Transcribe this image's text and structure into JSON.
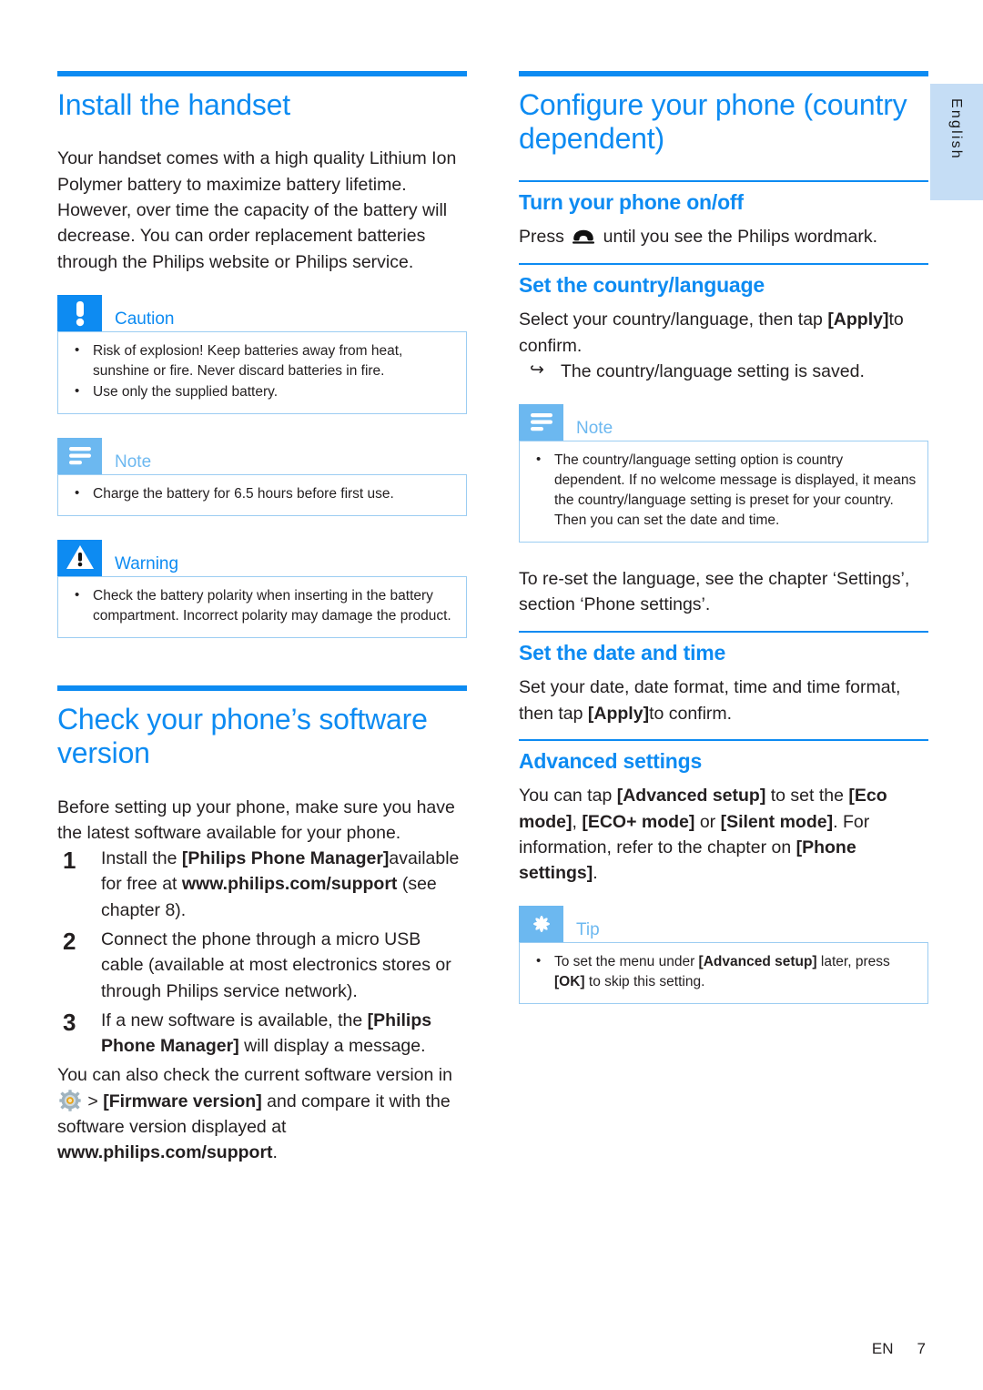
{
  "page": {
    "language_tab": "English",
    "footer_locale": "EN",
    "footer_page_number": "7",
    "accent_color": "#0d8bf2",
    "accent_light_color": "#6cb8f0",
    "tab_bg_color": "#c5ddf5"
  },
  "left_column": {
    "chapter_title": "Install the handset",
    "intro_paragraph": "Your handset comes with a high quality Lithium Ion Polymer battery to maximize battery lifetime. However, over time the capacity of the battery will decrease. You can order replacement batteries through the Philips website or Philips service.",
    "caution_box": {
      "icon": "exclamation-mark-icon",
      "title": "Caution",
      "items": [
        "Risk of explosion! Keep batteries away from heat, sunshine or fire. Never discard batteries in fire.",
        "Use only the supplied battery."
      ]
    },
    "note_box": {
      "icon": "note-lines-icon",
      "title": "Note",
      "items": [
        "Charge the battery for 6.5 hours before first use."
      ]
    },
    "warning_box": {
      "icon": "warning-triangle-icon",
      "title": "Warning",
      "items": [
        "Check the battery polarity when inserting in the battery compartment. Incorrect polarity may damage the product."
      ]
    },
    "chapter_title_2": "Check your phone’s software version",
    "intro_paragraph_2": "Before setting up your phone, make sure you have the latest software available for your phone.",
    "steps": [
      {
        "number": "1",
        "parts": [
          {
            "text": "Install the ",
            "bold": false
          },
          {
            "text": "[Philips Phone Manager]",
            "bold": true
          },
          {
            "text": "available for free at ",
            "bold": false
          },
          {
            "text": "www.philips.com/support",
            "bold": true
          },
          {
            "text": " (see chapter 8).",
            "bold": false
          }
        ]
      },
      {
        "number": "2",
        "parts": [
          {
            "text": "Connect the phone through a micro USB cable (available at most electronics stores or through Philips service network).",
            "bold": false
          }
        ]
      },
      {
        "number": "3",
        "parts": [
          {
            "text": "If a new software is available, the ",
            "bold": false
          },
          {
            "text": "[Philips Phone Manager]",
            "bold": true
          },
          {
            "text": " will display a message.",
            "bold": false
          }
        ]
      }
    ],
    "closing_paragraph": {
      "parts": [
        {
          "text": "You can also check the current software version in ",
          "bold": false
        },
        {
          "icon": "gear-icon"
        },
        {
          "text": " > ",
          "bold": false
        },
        {
          "text": "[Firmware version]",
          "bold": true
        },
        {
          "text": " and compare it with the software version displayed at ",
          "bold": false
        },
        {
          "text": "www.philips.com/support",
          "bold": true
        },
        {
          "text": ".",
          "bold": false
        }
      ]
    }
  },
  "right_column": {
    "chapter_title": "Configure your phone (country dependent)",
    "sections": [
      {
        "heading": "Turn your phone on/off",
        "body_parts": [
          {
            "text": "Press ",
            "bold": false
          },
          {
            "icon": "handset-icon"
          },
          {
            "text": " until you see the Philips wordmark.",
            "bold": false
          }
        ]
      },
      {
        "heading": "Set the country/language",
        "body_parts": [
          {
            "text": "Select your country/language, then tap ",
            "bold": false
          },
          {
            "text": "[Apply]",
            "bold": true
          },
          {
            "text": "to confirm.",
            "bold": false
          }
        ],
        "result": "The country/language setting is saved.",
        "result_arrow": "↪"
      }
    ],
    "note_box": {
      "icon": "note-lines-icon",
      "title": "Note",
      "items": [
        "The country/language setting option is country dependent. If no welcome message is displayed, it means the country/language setting is preset for your country. Then you can set the date and time."
      ]
    },
    "reset_paragraph": "To re-set the language, see the chapter ‘Settings’, section ‘Phone settings’.",
    "date_section": {
      "heading": "Set the date and time",
      "body_parts": [
        {
          "text": "Set your date, date format, time and time format, then tap ",
          "bold": false
        },
        {
          "text": "[Apply]",
          "bold": true
        },
        {
          "text": "to confirm.",
          "bold": false
        }
      ]
    },
    "advanced_section": {
      "heading": "Advanced settings",
      "body_parts": [
        {
          "text": "You can tap ",
          "bold": false
        },
        {
          "text": "[Advanced setup]",
          "bold": true
        },
        {
          "text": " to set the ",
          "bold": false
        },
        {
          "text": "[Eco mode]",
          "bold": true
        },
        {
          "text": ", ",
          "bold": false
        },
        {
          "text": "[ECO+ mode]",
          "bold": true
        },
        {
          "text": " or ",
          "bold": false
        },
        {
          "text": "[Silent mode]",
          "bold": true
        },
        {
          "text": ". For information, refer to the chapter on ",
          "bold": false
        },
        {
          "text": "[Phone settings]",
          "bold": true
        },
        {
          "text": ".",
          "bold": false
        }
      ]
    },
    "tip_box": {
      "icon": "asterisk-icon",
      "title": "Tip",
      "items": [
        {
          "parts": [
            {
              "text": "To set the menu under ",
              "bold": false
            },
            {
              "text": "[Advanced setup]",
              "bold": true
            },
            {
              "text": " later, press ",
              "bold": false
            },
            {
              "text": "[OK]",
              "bold": true
            },
            {
              "text": " to skip this setting.",
              "bold": false
            }
          ]
        }
      ]
    }
  }
}
